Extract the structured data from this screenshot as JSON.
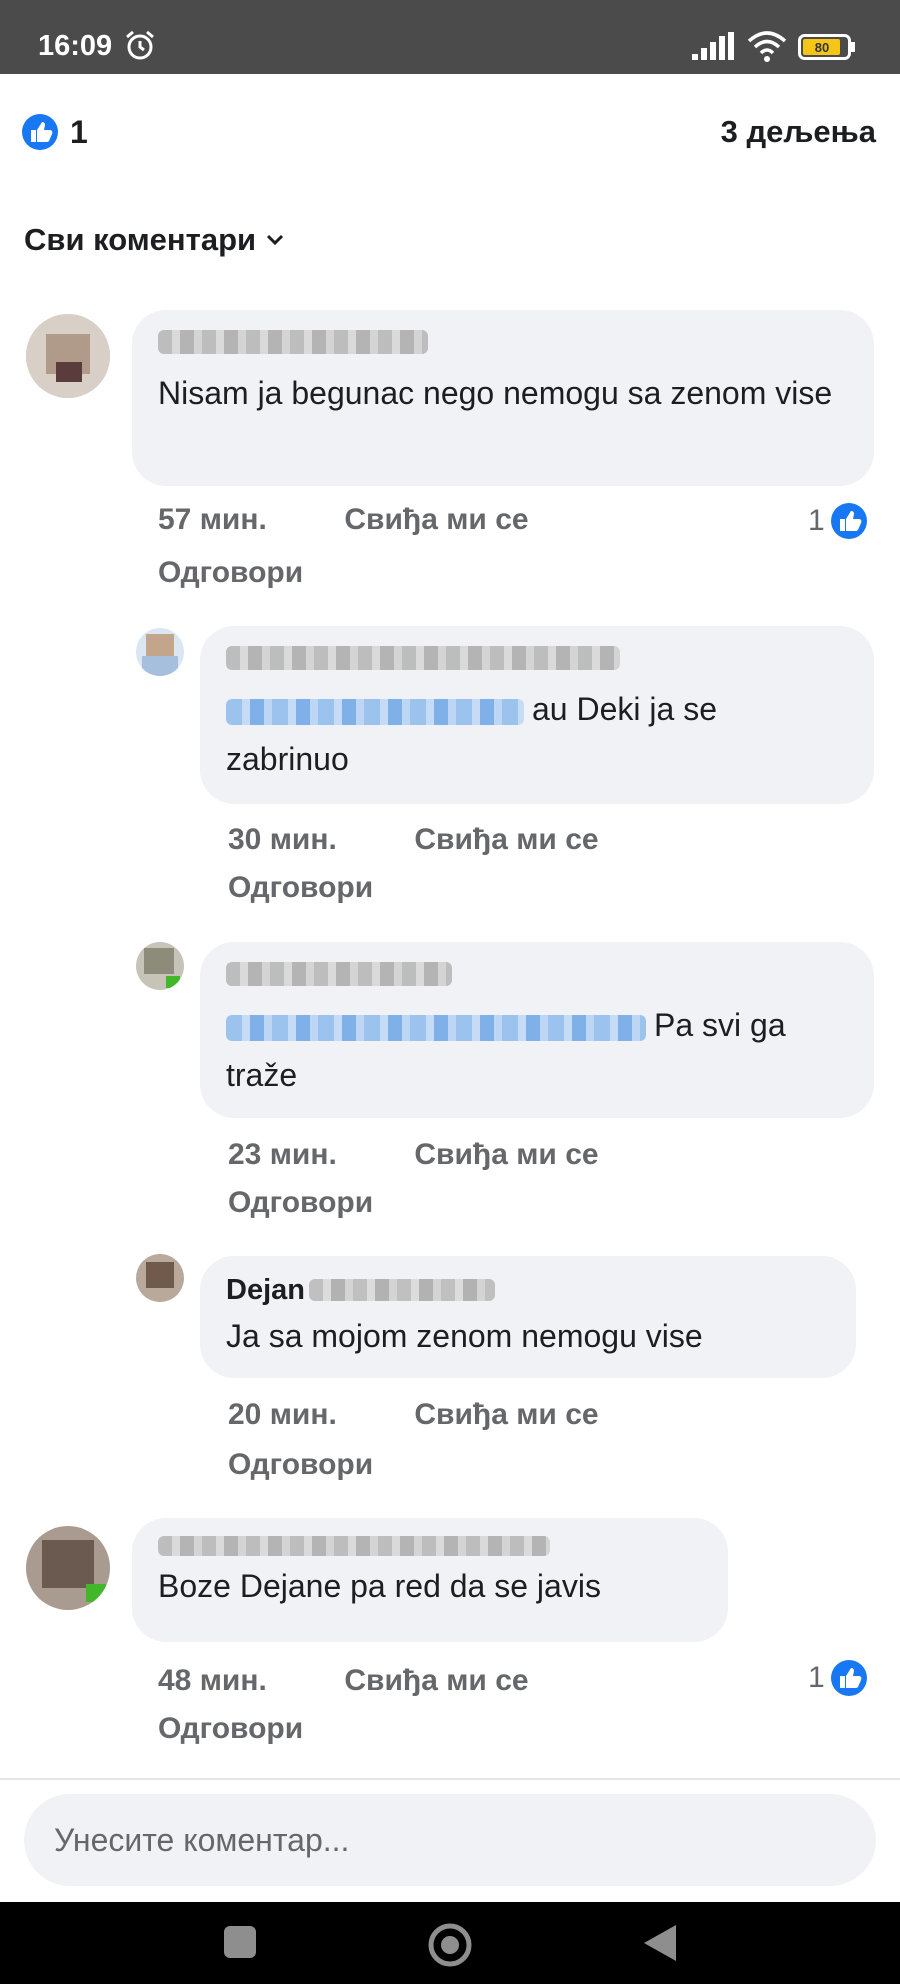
{
  "status": {
    "time": "16:09",
    "battery_level": "80",
    "icons": [
      "alarm-icon",
      "signal-icon",
      "wifi-icon",
      "battery-icon"
    ]
  },
  "reactions": {
    "like_count": "1",
    "shares": "3 дељења"
  },
  "filter": {
    "label": "Сви коментари"
  },
  "comments": [
    {
      "text": "Nisam ja begunac nego nemogu sa zenom vise",
      "time": "57 мин.",
      "like": "Свиђа ми се",
      "reply": "Одговори",
      "reactions": "1"
    },
    {
      "text": "au Deki ja se zabrinuo",
      "time": "30 мин.",
      "like": "Свиђа ми се",
      "reply": "Одговори"
    },
    {
      "text": "Pa svi ga traže",
      "time": "23 мин.",
      "like": "Свиђа ми се",
      "reply": "Одговори"
    },
    {
      "name": "Dejan",
      "text": "Ja sa mojom zenom nemogu vise",
      "time": "20 мин.",
      "like": "Свиђа ми се",
      "reply": "Одговори"
    },
    {
      "text": "Boze Dejane pa red da se javis",
      "time": "48 мин.",
      "like": "Свиђа ми се",
      "reply": "Одговори",
      "reactions": "1"
    }
  ],
  "input": {
    "placeholder": "Унесите коментар..."
  },
  "colors": {
    "accent": "#1877f2",
    "bubble": "#f0f2f5",
    "meta": "#65676b",
    "statusbar": "#4b4b4b"
  }
}
